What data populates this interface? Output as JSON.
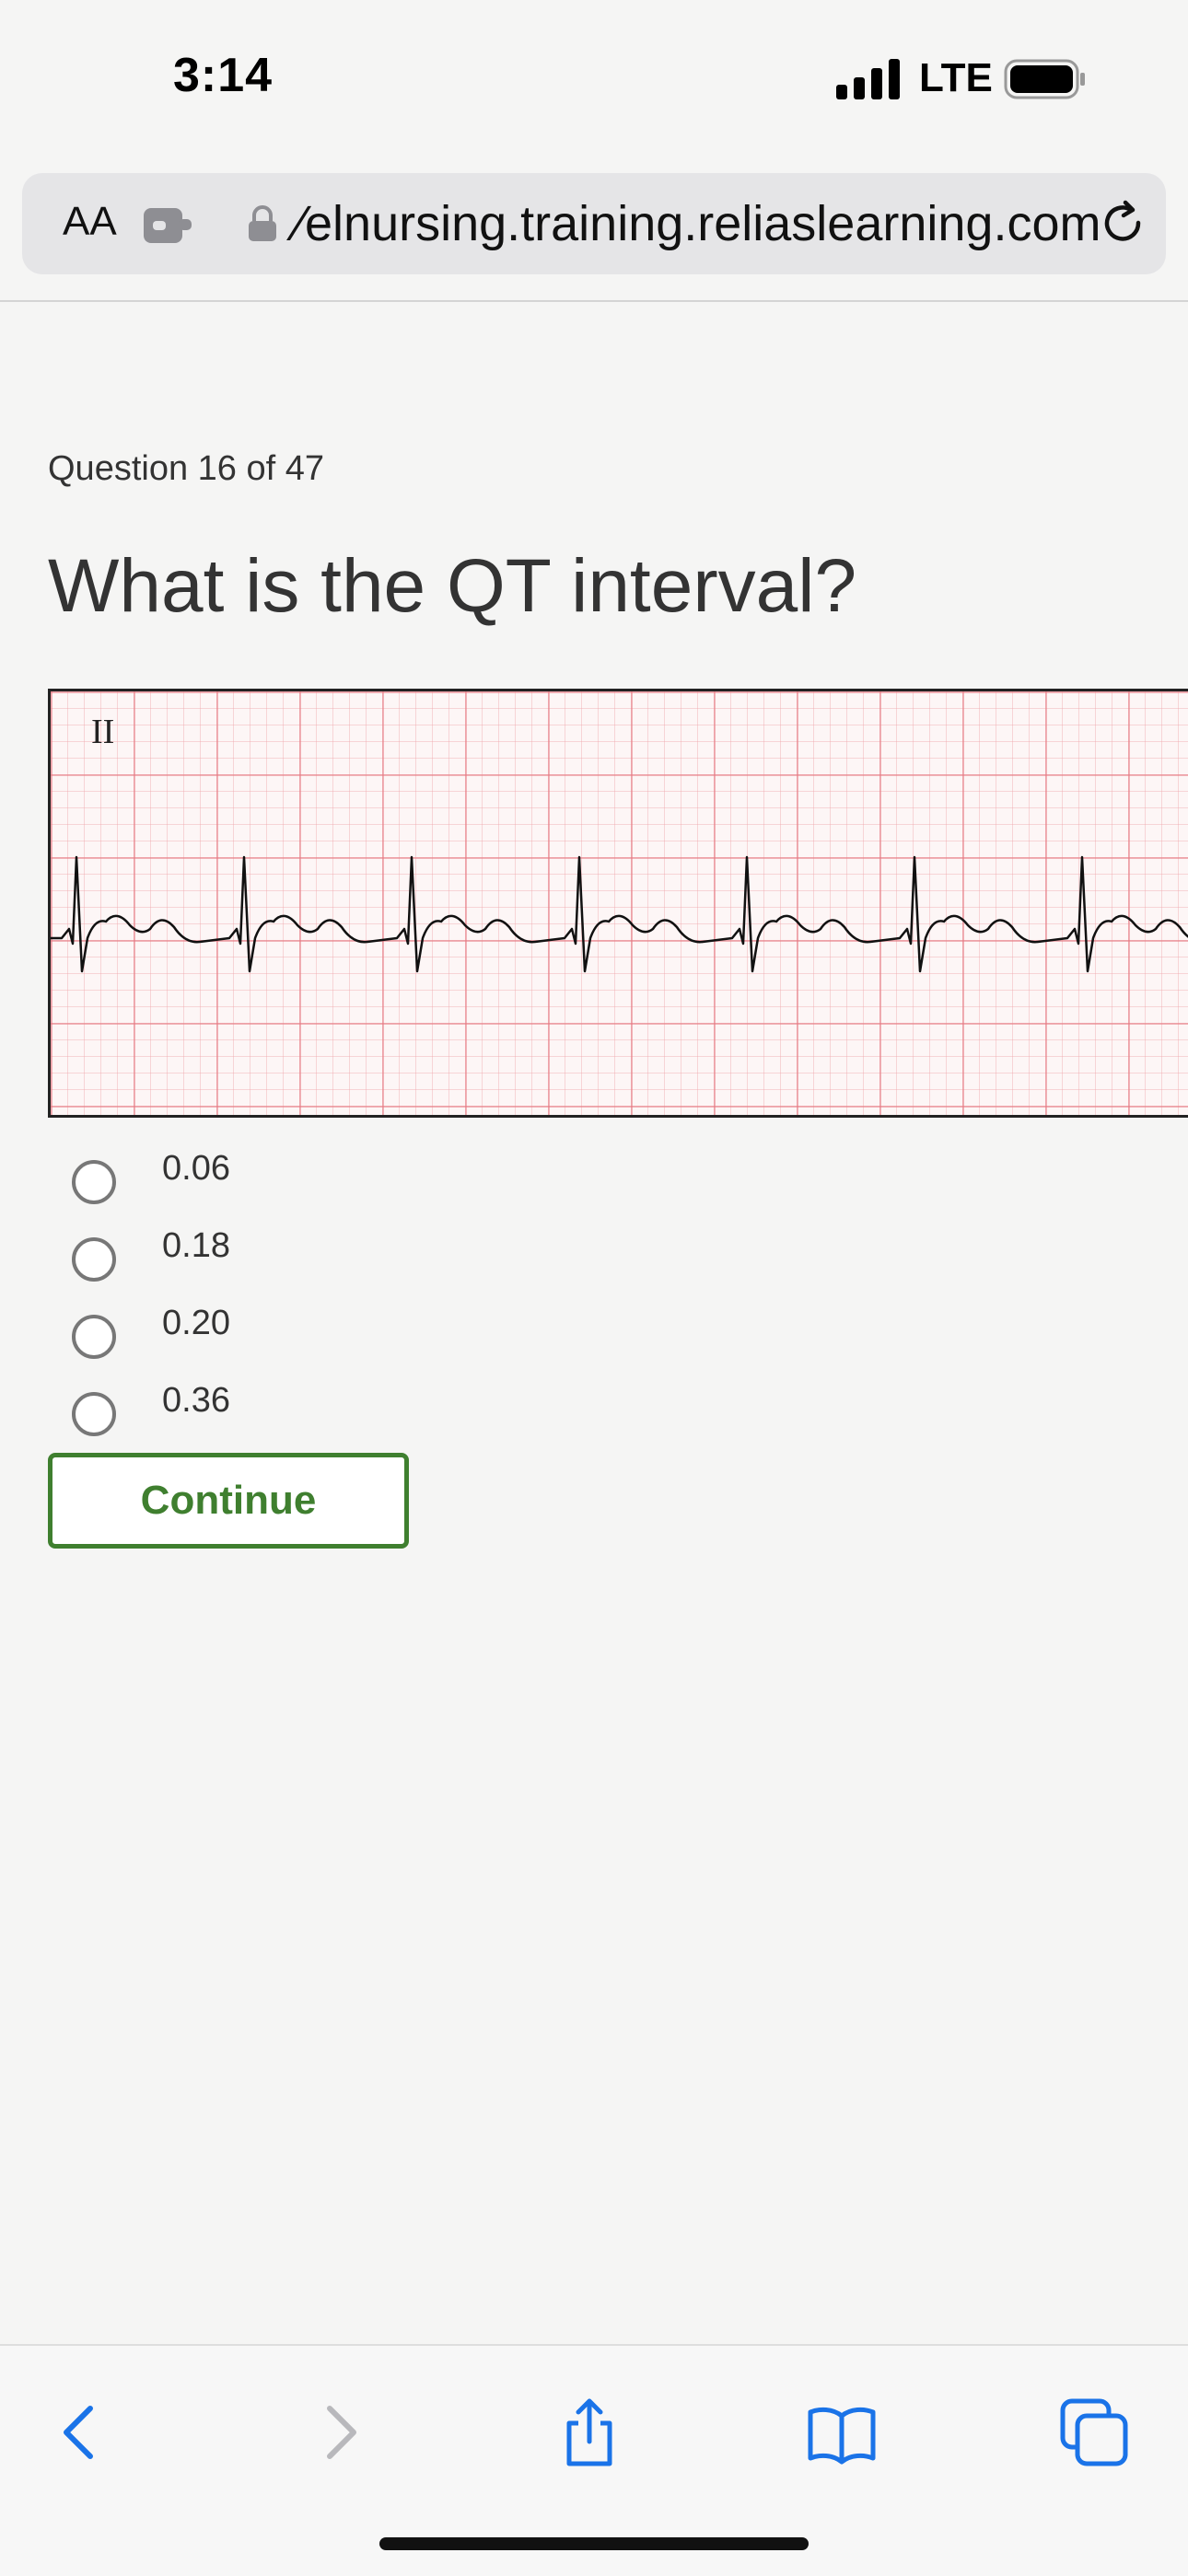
{
  "status_bar": {
    "time": "3:14",
    "network": "LTE"
  },
  "browser": {
    "text_size_label": "AA",
    "url": "∕elnursing.training.reliaslearning.com"
  },
  "question": {
    "counter": "Question 16 of 47",
    "title": "What is the QT interval?",
    "lead_label": "II",
    "options": [
      "0.06",
      "0.18",
      "0.20",
      "0.36"
    ],
    "continue_label": "Continue"
  },
  "colors": {
    "accent": "#3f7f2f",
    "link_blue": "#1a73e8",
    "grid": "#e6787f"
  },
  "icons": {
    "back": "chevron-left-icon",
    "forward": "chevron-right-icon",
    "share": "share-icon",
    "bookmarks": "book-icon",
    "tabs": "tabs-icon"
  }
}
